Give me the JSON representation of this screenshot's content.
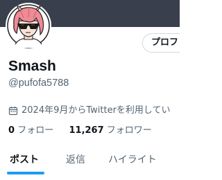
{
  "profile": {
    "name": "Smash",
    "handle": "@pufofa5788",
    "edit_label": "プロフ",
    "joined": "2024年9月からTwitterを利用してい",
    "following_count": "0",
    "following_label": "フォロー",
    "followers_count": "11,267",
    "followers_label": "フォロワー"
  },
  "tabs": [
    {
      "label": "ポスト",
      "active": true
    },
    {
      "label": "返信",
      "active": false
    },
    {
      "label": "ハイライト",
      "active": false
    }
  ],
  "icons": {
    "joined": "calendar-icon"
  },
  "colors": {
    "accent": "#1d9bf0",
    "banner": "#3a3f4d",
    "secondary_text": "#536471",
    "primary_text": "#0f1419"
  }
}
